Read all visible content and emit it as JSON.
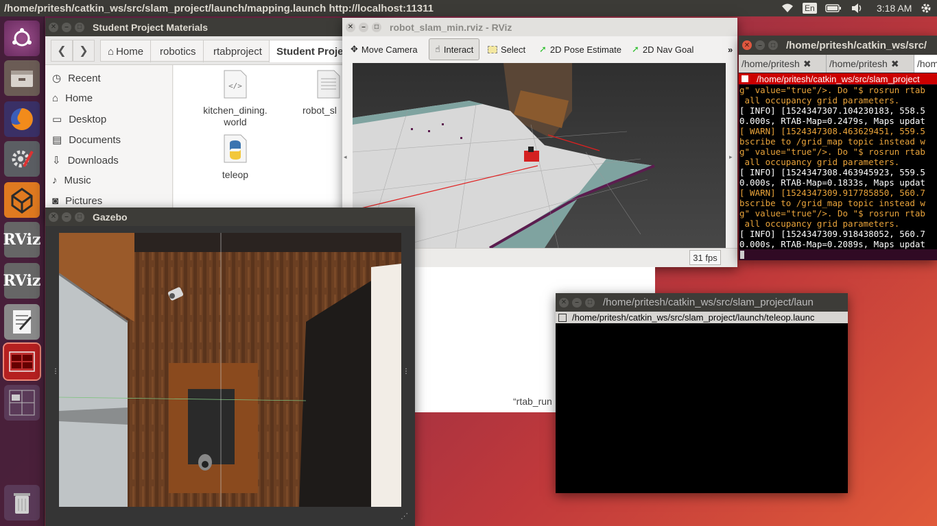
{
  "top_panel": {
    "title": "/home/pritesh/catkin_ws/src/slam_project/launch/mapping.launch http://localhost:11311",
    "keyboard": "En",
    "time": "3:18 AM"
  },
  "launcher": {
    "items": [
      "ubuntu-dash",
      "files",
      "firefox",
      "system-settings",
      "gazebo",
      "RViz",
      "RViz",
      "text-editor",
      "terminal",
      "workspace-switcher",
      "trash"
    ],
    "rviz_label": "RViz"
  },
  "files_window": {
    "title": "Student Project Materials",
    "crumbs": [
      "Home",
      "robotics",
      "rtabproject",
      "Student Proje"
    ],
    "sidebar": [
      "Recent",
      "Home",
      "Desktop",
      "Documents",
      "Downloads",
      "Music",
      "Pictures"
    ],
    "files": [
      {
        "name": "kitchen_dining.\nworld",
        "icon": "xml-file-icon"
      },
      {
        "name": "robot_sl",
        "icon": "text-file-icon"
      },
      {
        "name": "teleop",
        "icon": "python-file-icon"
      }
    ]
  },
  "rviz_window": {
    "title": "robot_slam_min.rviz - RViz",
    "tools": [
      "Move Camera",
      "Interact",
      "Select",
      "2D Pose Estimate",
      "2D Nav Goal"
    ],
    "active_tool": "Interact",
    "fps": "31 fps",
    "rtab_text": "“rtab_run"
  },
  "gazebo_window": {
    "title": "Gazebo"
  },
  "terminal_main": {
    "title": "/home/pritesh/catkin_ws/src/",
    "tabs": [
      "/home/pritesh",
      "/home/pritesh",
      "/hom"
    ],
    "header": "/home/pritesh/catkin_ws/src/slam_project",
    "lines": [
      {
        "text": "g\" value=\"true\"/>. Do \"$ rosrun rtab",
        "cls": "warn"
      },
      {
        "text": " all occupancy grid parameters.",
        "cls": "warn"
      },
      {
        "text": "[ INFO] [1524347307.104230183, 558.5",
        "cls": ""
      },
      {
        "text": "0.000s, RTAB-Map=0.2479s, Maps updat",
        "cls": ""
      },
      {
        "text": "[ WARN] [1524347308.463629451, 559.5",
        "cls": "warn"
      },
      {
        "text": "bscribe to /grid_map topic instead w",
        "cls": "warn"
      },
      {
        "text": "g\" value=\"true\"/>. Do \"$ rosrun rtab",
        "cls": "warn"
      },
      {
        "text": " all occupancy grid parameters.",
        "cls": "warn"
      },
      {
        "text": "[ INFO] [1524347308.463945923, 559.5",
        "cls": ""
      },
      {
        "text": "0.000s, RTAB-Map=0.1833s, Maps updat",
        "cls": ""
      },
      {
        "text": "[ WARN] [1524347309.917785850, 560.7",
        "cls": "warn"
      },
      {
        "text": "bscribe to /grid_map topic instead w",
        "cls": "warn"
      },
      {
        "text": "g\" value=\"true\"/>. Do \"$ rosrun rtab",
        "cls": "warn"
      },
      {
        "text": " all occupancy grid parameters.",
        "cls": "warn"
      },
      {
        "text": "[ INFO] [1524347309.918438052, 560.7",
        "cls": ""
      },
      {
        "text": "0.000s, RTAB-Map=0.2089s, Maps updat",
        "cls": ""
      }
    ]
  },
  "terminal_teleop": {
    "title": "/home/pritesh/catkin_ws/src/slam_project/laun",
    "header": "/home/pritesh/catkin_ws/src/slam_project/launch/teleop.launc"
  },
  "colors": {
    "panel": "#3c3b37",
    "terminal_bg": "#000000",
    "warn": "#e9a33a",
    "close_red": "#e0573f"
  }
}
